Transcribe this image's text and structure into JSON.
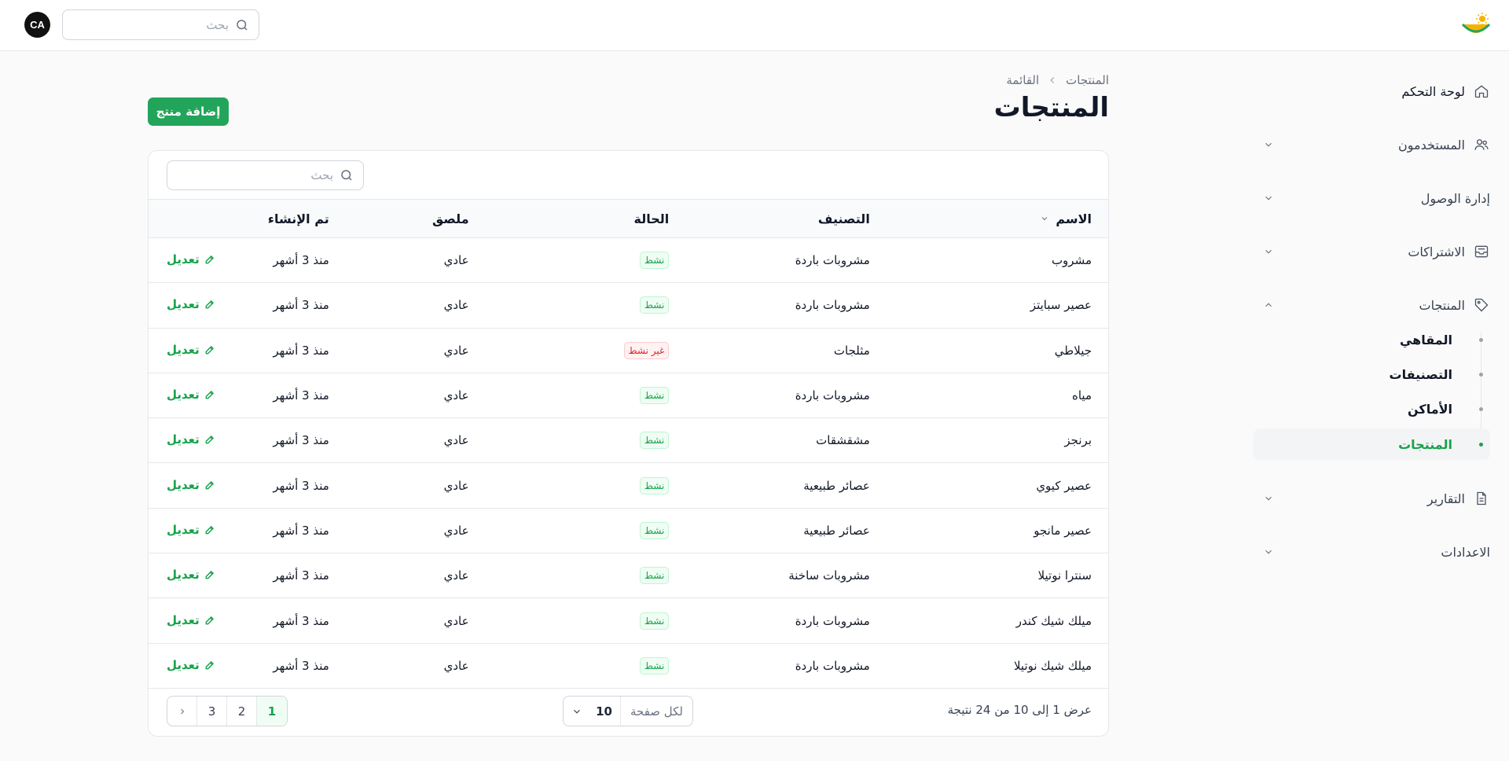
{
  "topbar": {
    "search_placeholder": "بحث",
    "avatar_initials": "CA"
  },
  "sidebar": {
    "items": [
      {
        "label": "لوحة التحكم",
        "icon": "home-icon",
        "expandable": false
      },
      {
        "label": "المستخدمون",
        "icon": "users-icon",
        "expandable": true
      },
      {
        "label": "إدارة الوصول",
        "icon": "",
        "expandable": true
      },
      {
        "label": "الاشتراكات",
        "icon": "inbox-icon",
        "expandable": true
      },
      {
        "label": "المنتجات",
        "icon": "tag-icon",
        "expandable": true,
        "expanded": true
      },
      {
        "label": "التقارير",
        "icon": "document-icon",
        "expandable": true
      },
      {
        "label": "الاعدادات",
        "icon": "",
        "expandable": true
      }
    ],
    "products_subitems": [
      {
        "label": "المقاهي",
        "active": false
      },
      {
        "label": "التصنيفات",
        "active": false
      },
      {
        "label": "الأماكن",
        "active": false
      },
      {
        "label": "المنتجات",
        "active": true
      }
    ]
  },
  "breadcrumb": {
    "root": "المنتجات",
    "current": "القائمة"
  },
  "page": {
    "title": "المنتجات",
    "add_button": "إضافة منتج"
  },
  "table": {
    "search_placeholder": "بحث",
    "headers": {
      "name": "الاسم",
      "category": "التصنيف",
      "status": "الحالة",
      "tag": "ملصق",
      "created": "تم الإنشاء"
    },
    "edit_label": "تعديل",
    "rows": [
      {
        "name": "مشروب",
        "category": "مشروبات باردة",
        "status": "نشط",
        "active": true,
        "tag": "عادي",
        "created": "منذ 3 أشهر"
      },
      {
        "name": "عصير سبايتز",
        "category": "مشروبات باردة",
        "status": "نشط",
        "active": true,
        "tag": "عادي",
        "created": "منذ 3 أشهر"
      },
      {
        "name": "جيلاطي",
        "category": "مثلجات",
        "status": "غير نشط",
        "active": false,
        "tag": "عادي",
        "created": "منذ 3 أشهر"
      },
      {
        "name": "مياه",
        "category": "مشروبات باردة",
        "status": "نشط",
        "active": true,
        "tag": "عادي",
        "created": "منذ 3 أشهر"
      },
      {
        "name": "برنجز",
        "category": "مشقشقات",
        "status": "نشط",
        "active": true,
        "tag": "عادي",
        "created": "منذ 3 أشهر"
      },
      {
        "name": "عصير كيوي",
        "category": "عصائر طبيعية",
        "status": "نشط",
        "active": true,
        "tag": "عادي",
        "created": "منذ 3 أشهر"
      },
      {
        "name": "عصير مانجو",
        "category": "عصائر طبيعية",
        "status": "نشط",
        "active": true,
        "tag": "عادي",
        "created": "منذ 3 أشهر"
      },
      {
        "name": "سنترا نوتيلا",
        "category": "مشروبات ساخنة",
        "status": "نشط",
        "active": true,
        "tag": "عادي",
        "created": "منذ 3 أشهر"
      },
      {
        "name": "ميلك شيك كندر",
        "category": "مشروبات باردة",
        "status": "نشط",
        "active": true,
        "tag": "عادي",
        "created": "منذ 3 أشهر"
      },
      {
        "name": "ميلك شيك نوتيلا",
        "category": "مشروبات باردة",
        "status": "نشط",
        "active": true,
        "tag": "عادي",
        "created": "منذ 3 أشهر"
      }
    ]
  },
  "footer": {
    "results_text": "عرض 1 إلى 10 من 24 نتيجة",
    "per_page_label": "لكل صفحة",
    "per_page_value": "10",
    "pages": [
      "1",
      "2",
      "3"
    ],
    "current_page": "1"
  },
  "colors": {
    "accent": "#22a55a",
    "active_text": "#16a34a",
    "inactive_text": "#dc2626"
  }
}
